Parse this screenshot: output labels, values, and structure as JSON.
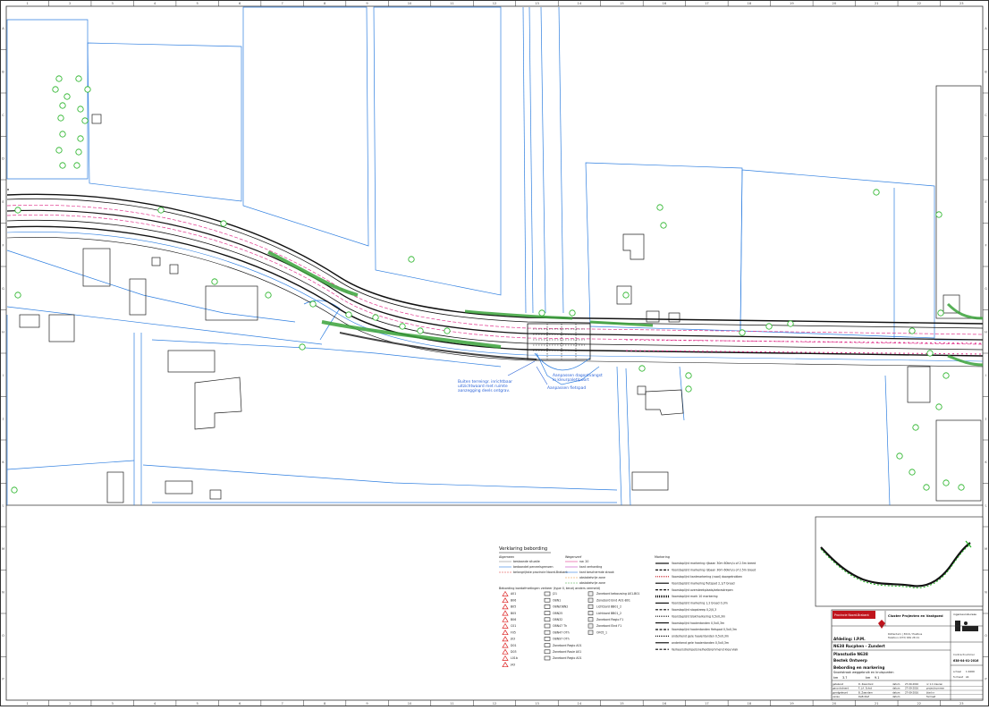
{
  "sheet": {
    "grid_cols": [
      "1",
      "2",
      "3",
      "4",
      "5",
      "6",
      "7",
      "8",
      "9",
      "10",
      "11",
      "12",
      "13",
      "14",
      "15",
      "16",
      "17",
      "18",
      "19",
      "20",
      "21",
      "22",
      "23"
    ],
    "grid_rows": [
      "A",
      "B",
      "C",
      "D",
      "E",
      "F",
      "G",
      "H",
      "I",
      "J",
      "K",
      "L",
      "M",
      "N",
      "O",
      "P"
    ]
  },
  "map": {
    "annotations": [
      "Buiten terreingr. inrichtbaar",
      "uitzichtwaard met ruimte",
      "aanzegging deels ontgrav.",
      "Aanpassen dagontvangst",
      "in kleurpalet/poort",
      "Aanpassen fietspad"
    ],
    "colors": {
      "road": "#111111",
      "parcel": "#2f7fe0",
      "planting": "#3aa23a",
      "markings": "#e0368d",
      "trees": "#1fb11f"
    }
  },
  "legend": {
    "title": "Verklaring bebording",
    "col1_heading": "Algemeen",
    "col1": [
      "bestaande situatie",
      "bedaandet perceelsgrenzen",
      "belangrijkste provincie Noord-Brabant"
    ],
    "col2_heading": "Wegenverf",
    "col2": [
      "nw. 20",
      "kant verharding",
      "kant beschermde strook",
      "obstakelvrije zone",
      "obstakelvrije zone"
    ],
    "sign_heading": "Bebording bordafmetingen verkeer (type II, tenzij anders vermeld)",
    "signs_a": [
      "A01",
      "B06",
      "B05",
      "B05",
      "B06",
      "C01",
      "F05",
      "J03",
      "D01",
      "D03",
      "L01b",
      "J43"
    ],
    "signs_b": [
      "J21",
      "OBN1",
      "OBN/OBN2",
      "OBN25",
      "OBN32",
      "OBN47 Th",
      "OBN47 OTh",
      "OBN97 OTh",
      "Zonebord Regio A01",
      "Zonebord Rosie A01",
      "Zonebord Regio A01"
    ],
    "signs_c": [
      "Zonebord bebouwing A01-B01",
      "Zonebord Eind A01-B01",
      "Lichtbord BB01_2",
      "Lichtbord BB01_2",
      "Zonebord Regio F1",
      "Zonebord Eind F1",
      "OF05_1"
    ],
    "mark_heading": "Markering",
    "markings": [
      "Voorstaplijnt markering rijbaan 30m 60km/u of 2.5m breed",
      "Voorstaplijnt markering rijbaan 30m 60km/u of 2.5m breed",
      "Voorstaplijnt kantmarkering (rood) doorgetrokken",
      "Voorstaplijnt markering fietspad 2,1/7 breed",
      "Voorstaplijnt oversteekplaats/zebrastrepen",
      "Voorstaplijnt mark 10 markering",
      "Voorstaplijnt markering 1,2 breed 0,3m",
      "Voorstaplijnt stopstreep 0,2/0,3",
      "Voorstaplijnt blokmarkering 0,5x0,3m",
      "Voorstaplijnt haaientanden 0,5x0,3m",
      "Voorstaplijnt haaientanden fietspad 0,5x0,3m",
      "onderkend gele haaientanden 0,5x0,3m",
      "onderkend gele haaientanden 0,5x0,3m",
      "Verkeersdrempel/snelheidsremmend kleurvlak"
    ]
  },
  "title_block": {
    "client": "Provincie Noord-Brabant",
    "party": "Cluster Projecten en Vastgoed",
    "company": "ingenieursbureau",
    "address": "Rotterdam | 3016 / Postbus",
    "phone": "Telefoon (073) 681 28 21",
    "dept": "Afdeling: I.P.M.",
    "road": "N638 Rucphen - Zundert",
    "drawing_heading": "Planstudie N638",
    "phase": "Bestek Ontwerp",
    "subject": "Bebording en markering",
    "detail": "Snoeistrook weggebruik en kruispunten",
    "km_from_label": "km",
    "km_from": "3.7",
    "km_to_label": "km",
    "km_to": "9.1",
    "drawing_number_label": "Contractnummer",
    "drawing_number": "638-04-01-2016",
    "scale_label": "schaal",
    "scale": "1:1000",
    "format_label": "formaat",
    "format": "A1",
    "rows": [
      [
        "getekend",
        "D. Zaandonk",
        "datum",
        "27-09-2016",
        "nr 1.1 kleuren"
      ],
      [
        "gecontroleerd",
        "F. J.A. Schot",
        "datum",
        "27-09-2016",
        "projectnummer"
      ],
      [
        "goedgekeurd",
        "B. Zaandam",
        "datum",
        "27-09-2016",
        "blad nr"
      ],
      [
        "versie",
        "Definitief",
        "datum",
        "",
        "formaat"
      ]
    ]
  }
}
